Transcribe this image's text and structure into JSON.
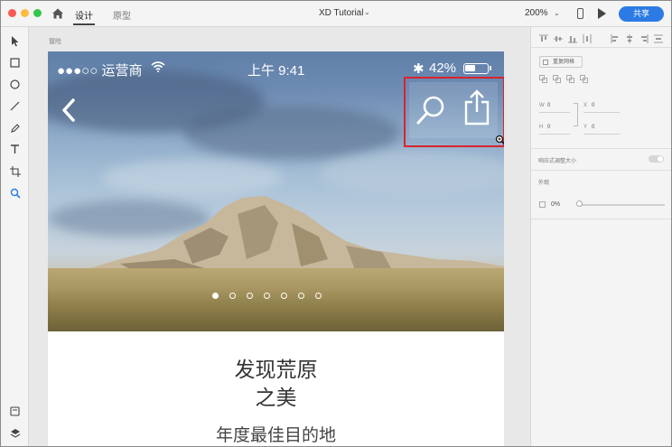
{
  "app": {
    "tabs": [
      {
        "label": "设计"
      },
      {
        "label": "原型"
      }
    ],
    "document_title": "XD Tutorial",
    "zoom": "200%",
    "share_label": "共享"
  },
  "toolbar": {
    "tools": [
      "select-arrow-icon",
      "rectangle-icon",
      "ellipse-icon",
      "line-icon",
      "pen-icon",
      "text-icon",
      "artboard-icon",
      "zoom-search-icon"
    ],
    "bottom": [
      "assets-icon",
      "layers-icon"
    ]
  },
  "canvas": {
    "artboard_label": "冒险",
    "status_bar": {
      "carrier": "●●●○○ 运营商",
      "time": "上午 9:41",
      "bluetooth": "✱",
      "battery_percent": "42%"
    },
    "carousel": {
      "count": 7,
      "active_index": 0
    },
    "heading_line1": "发现荒原",
    "heading_line2": "之美",
    "subheading": "年度最佳目的地"
  },
  "panel": {
    "repeat_grid_label": "重复网格",
    "w_label": "W",
    "w_value": "0",
    "h_label": "H",
    "h_value": "0",
    "x_label": "X",
    "x_value": "0",
    "y_label": "Y",
    "y_value": "0",
    "responsive_label": "响应式调整大小",
    "appearance_label": "外观",
    "opacity_value": "0%"
  },
  "colors": {
    "accent": "#2c7be5",
    "selection": "#d9232e"
  }
}
